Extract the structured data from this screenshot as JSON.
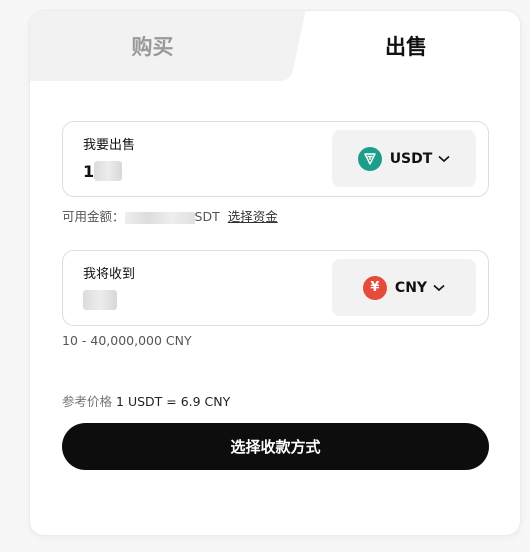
{
  "tabs": {
    "buy": "购买",
    "sell": "出售",
    "active": "sell"
  },
  "sell_field": {
    "label": "我要出售",
    "value_digit": "1",
    "currency": "USDT",
    "coin_icon": "tether-icon",
    "coin_color": "#1b9e8a"
  },
  "available": {
    "prefix": "可用金额：",
    "suffix": "SDT",
    "link": "选择资金"
  },
  "receive_field": {
    "label": "我将收到",
    "value_digit": "6",
    "currency": "CNY",
    "coin_icon": "yuan-icon",
    "coin_symbol": "¥",
    "coin_color": "#e54b3c"
  },
  "range_text": "10 - 40,000,000 CNY",
  "price": {
    "label": "参考价格",
    "value": "1 USDT = 6.9 CNY"
  },
  "submit_label": "选择收款方式"
}
